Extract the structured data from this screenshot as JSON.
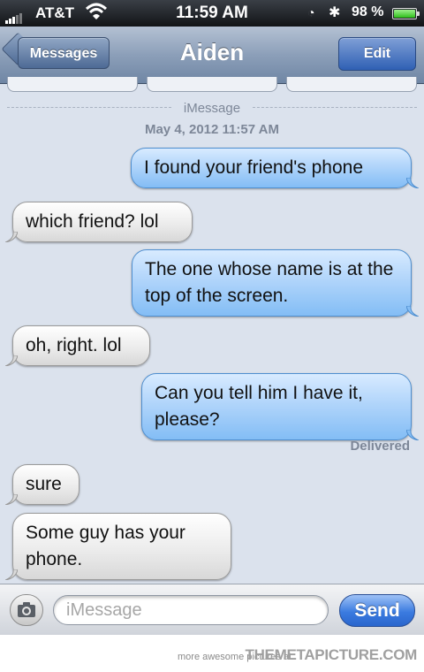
{
  "status_bar": {
    "carrier": "AT&T",
    "time": "11:59 AM",
    "battery_percent": "98 %",
    "battery_level": 0.98,
    "icons": [
      "signal-icon",
      "wifi-icon",
      "lock-rotation-icon",
      "bluetooth-icon",
      "battery-icon"
    ]
  },
  "nav": {
    "back_label": "Messages",
    "title": "Aiden",
    "edit_label": "Edit"
  },
  "thread": {
    "service_label": "iMessage",
    "timestamp": "May 4, 2012 11:57 AM",
    "delivered_label": "Delivered",
    "messages": [
      {
        "from": "me",
        "text": "I found your friend's phone"
      },
      {
        "from": "them",
        "text": "which friend? lol"
      },
      {
        "from": "me",
        "text": "The one whose name is at the top of the screen."
      },
      {
        "from": "them",
        "text": "oh, right. lol"
      },
      {
        "from": "me",
        "text": "Can you tell him I have it, please?"
      },
      {
        "from": "them",
        "text": "sure"
      },
      {
        "from": "them",
        "text": "Some guy has your phone."
      }
    ]
  },
  "input_bar": {
    "placeholder": "iMessage",
    "value": "",
    "send_label": "Send"
  },
  "watermark": {
    "prefix": "more awesome pictures at",
    "brand": "THEMETAPICTURE.COM"
  },
  "colors": {
    "background": "#dbe2ed",
    "outgoing_bubble": "#a6cdf8",
    "incoming_bubble": "#ececec",
    "send_button": "#3b7be0"
  }
}
